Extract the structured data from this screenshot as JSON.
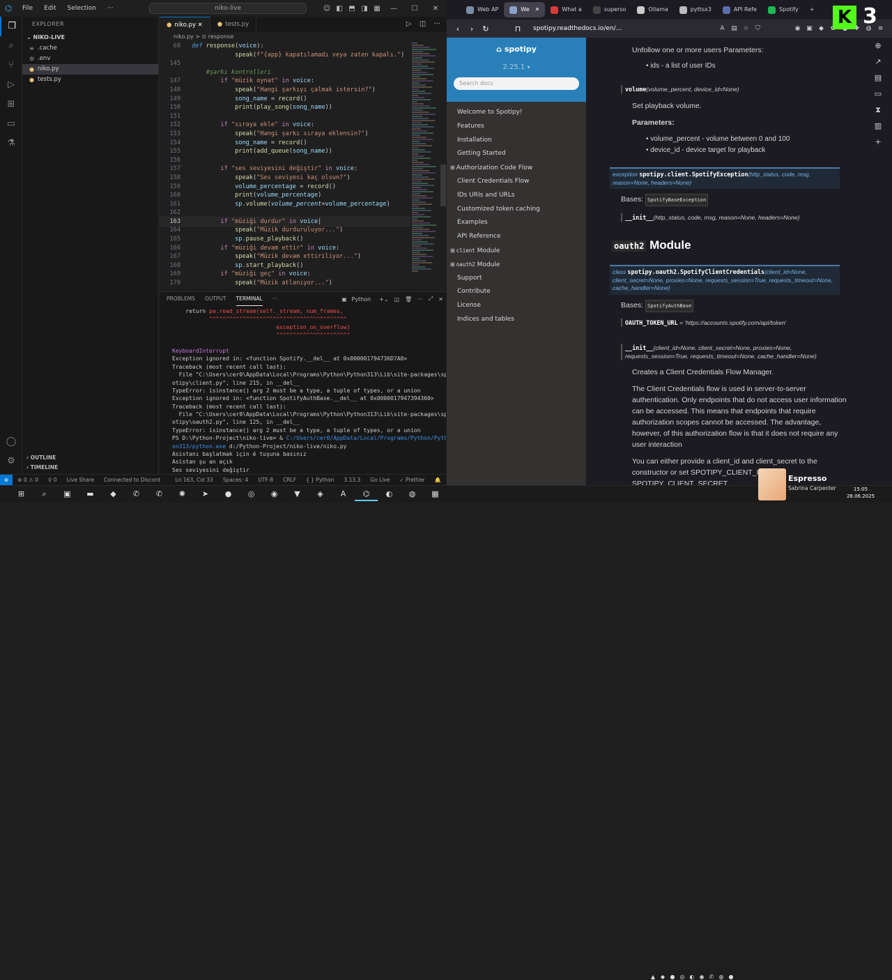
{
  "vscode": {
    "menu": [
      "File",
      "Edit",
      "Selection",
      "···"
    ],
    "command_center": "niko-live",
    "explorer": {
      "title": "EXPLORER",
      "folder": "NIKO-LIVE",
      "files": [
        {
          "name": ".cache",
          "icon": "≡"
        },
        {
          "name": ".env",
          "icon": "⚙"
        },
        {
          "name": "niko.py",
          "icon": "●"
        },
        {
          "name": "tests.py",
          "icon": "●"
        }
      ],
      "outline": "OUTLINE",
      "timeline": "TIMELINE"
    },
    "tabs": [
      {
        "label": "niko.py",
        "active": true
      },
      {
        "label": "tests.py",
        "active": false
      }
    ],
    "breadcrumb": "niko.py  >  ⊙ response",
    "code": [
      {
        "n": "68",
        "html": "<span class='def'>def</span> <span class='fn'>response</span>(<span class='var'>voice</span>):"
      },
      {
        "n": "",
        "html": "            <span class='fn'>speak</span>(<span class='str'>f\"{app} kapatılamadı veya zaten kapalı.\"</span>)"
      },
      {
        "n": "145",
        "html": ""
      },
      {
        "n": "",
        "html": "    <span class='cm'>#şarkı kontrolleri</span>"
      },
      {
        "n": "147",
        "html": "        <span class='kw'>if</span> <span class='str'>\"müzik oynat\"</span> <span class='kw'>in</span> <span class='var'>voice</span>:"
      },
      {
        "n": "148",
        "html": "            <span class='fn'>speak</span>(<span class='str'>\"Hangi şarkıyı çalmak istersin?\"</span>)"
      },
      {
        "n": "149",
        "html": "            <span class='var'>song_name</span> = <span class='fn'>record</span>()"
      },
      {
        "n": "150",
        "html": "            <span class='fn'>print</span>(<span class='fn'>play_song</span>(<span class='var'>song_name</span>))"
      },
      {
        "n": "151",
        "html": ""
      },
      {
        "n": "152",
        "html": "        <span class='kw'>if</span> <span class='str'>\"sıraya ekle\"</span> <span class='kw'>in</span> <span class='var'>voice</span>:"
      },
      {
        "n": "153",
        "html": "            <span class='fn'>speak</span>(<span class='str'>\"Hangi şarkı sıraya eklensin?\"</span>)"
      },
      {
        "n": "154",
        "html": "            <span class='var'>song_name</span> = <span class='fn'>record</span>()"
      },
      {
        "n": "155",
        "html": "            <span class='fn'>print</span>(<span class='fn'>add_queue</span>(<span class='var'>song_name</span>))"
      },
      {
        "n": "156",
        "html": ""
      },
      {
        "n": "157",
        "html": "        <span class='kw'>if</span> <span class='str'>\"ses seviyesini değiştir\"</span> <span class='kw'>in</span> <span class='var'>voice</span>:"
      },
      {
        "n": "158",
        "html": "            <span class='fn'>speak</span>(<span class='str'>\"Ses seviyesi kaç olsun?\"</span>)"
      },
      {
        "n": "159",
        "html": "            <span class='var'>volume_percentage</span> = <span class='fn'>record</span>()"
      },
      {
        "n": "160",
        "html": "            <span class='fn'>print</span>(<span class='var'>volume_percentage</span>)"
      },
      {
        "n": "161",
        "html": "            <span class='var'>sp</span>.<span class='fn'>volume</span>(<span class='var' style='font-style:italic'>volume_percent</span>=<span class='var'>volume_percentage</span>)"
      },
      {
        "n": "162",
        "html": ""
      },
      {
        "n": "163",
        "html": "        <span class='kw'>if</span> <span class='str'>\"müziği durdur\"</span> <span class='kw'>in</span> <span class='var'>voice</span>|",
        "cur": true
      },
      {
        "n": "164",
        "html": "            <span class='fn'>speak</span>(<span class='str'>\"Müzik durduruluyor...\"</span>)"
      },
      {
        "n": "165",
        "html": "            <span class='var'>sp</span>.<span class='fn'>pause_playback</span>()"
      },
      {
        "n": "166",
        "html": "        <span class='kw'>if</span> <span class='str'>\"müziği devam ettir\"</span> <span class='kw'>in</span> <span class='var'>voice</span>:"
      },
      {
        "n": "167",
        "html": "            <span class='fn'>speak</span>(<span class='str'>\"Müzik devam ettiriliyor...\"</span>)"
      },
      {
        "n": "168",
        "html": "            <span class='var'>sp</span>.<span class='fn'>start_playback</span>()"
      },
      {
        "n": "169",
        "html": "        <span class='kw'>if</span> <span class='str'>\"müziği geç\"</span> <span class='kw'>in</span> <span class='var'>voice</span>:"
      },
      {
        "n": "170",
        "html": "            <span class='fn'>speak</span>(<span class='str'>\"Müzik atlanıyor...\"</span>)"
      }
    ],
    "panel_tabs": [
      {
        "label": "PROBLEMS",
        "active": false
      },
      {
        "label": "OUTPUT",
        "active": false
      },
      {
        "label": "TERMINAL",
        "active": true
      },
      {
        "label": "···",
        "active": false
      }
    ],
    "terminal_profile": "Python",
    "terminal": [
      {
        "cls": "",
        "html": "    return <span class='red'>pa.read_stream(self._stream, num_frames,</span>"
      },
      {
        "cls": "err",
        "html": "           ^^^^^^^^^^^^^^^^^^^^^^^^^^^^^^^^^^^^^^^^^"
      },
      {
        "cls": "err",
        "html": "                               exception_on_overflow)"
      },
      {
        "cls": "err",
        "html": "                               ^^^^^^^^^^^^^^^^^^^^^^"
      },
      {
        "cls": "",
        "html": ""
      },
      {
        "cls": "purple",
        "html": "KeyboardInterrupt"
      },
      {
        "cls": "",
        "html": "Exception ignored in: &lt;function Spotify.__del__ at 0x000001794736D7A0&gt;"
      },
      {
        "cls": "",
        "html": "Traceback (most recent call last):"
      },
      {
        "cls": "",
        "html": "  File \"C:\\Users\\cer0\\AppData\\Local\\Programs\\Python\\Python313\\Lib\\site-packages\\sp"
      },
      {
        "cls": "",
        "html": "otipy\\client.py\", line 215, in __del__"
      },
      {
        "cls": "",
        "html": "TypeError: isinstance() arg 2 must be a type, a tuple of types, or a union"
      },
      {
        "cls": "",
        "html": "Exception ignored in: &lt;function SpotifyAuthBase.__del__ at 0x0000017947394360&gt;"
      },
      {
        "cls": "",
        "html": "Traceback (most recent call last):"
      },
      {
        "cls": "",
        "html": "  File \"C:\\Users\\cer0\\AppData\\Local\\Programs\\Python\\Python313\\Lib\\site-packages\\sp"
      },
      {
        "cls": "",
        "html": "otipy\\oauth2.py\", line 125, in __del__"
      },
      {
        "cls": "",
        "html": "TypeError: isinstance() arg 2 must be a type, a tuple of types, or a union"
      },
      {
        "cls": "",
        "html": "PS D:\\Python-Project\\niko-live&gt; &amp; <span class='path'>C:/Users/cer0/AppData/Local/Programs/Python/Pyth</span>"
      },
      {
        "cls": "",
        "html": "<span class='path'>on313/python.exe</span> d:/Python-Project/niko-live/niko.py"
      },
      {
        "cls": "",
        "html": "Asistanı başlatmak için é tuşuna basınız"
      },
      {
        "cls": "",
        "html": "Asistan şu an açık"
      },
      {
        "cls": "",
        "html": "Ses seviyesini değiştir"
      }
    ],
    "status": {
      "remote": "⊗",
      "problems": "⊗ 0 ⚠ 0",
      "ports": "⚲ 0",
      "live_share": "Live Share",
      "discord": "Connected to Discord",
      "position": "Ln 163, Col 33",
      "spaces": "Spaces: 4",
      "encoding": "UTF-8",
      "eol": "CRLF",
      "language": "{ } Python",
      "version": "3.13.3",
      "golive": "Go Live",
      "prettier": "✓ Prettier"
    }
  },
  "browser": {
    "tabs": [
      {
        "label": "Web AP",
        "color": "#7b8ea8",
        "active": false
      },
      {
        "label": "We",
        "color": "#8aa0c8",
        "active": true
      },
      {
        "label": "What a",
        "color": "#d63c3c",
        "active": false
      },
      {
        "label": "superso",
        "color": "#444444",
        "active": false
      },
      {
        "label": "Ollama",
        "color": "#cccccc",
        "active": false
      },
      {
        "label": "pyttsx3",
        "color": "#bbbbbb",
        "active": false
      },
      {
        "label": "API Refe",
        "color": "#5a6ea8",
        "active": false
      },
      {
        "label": "Spotify",
        "color": "#1db954",
        "active": false
      }
    ],
    "url": "spotipy.readthedocs.io/en/...",
    "docs": {
      "brand": "⌂ spotipy",
      "version": "2.25.1",
      "search_placeholder": "Search docs",
      "nav": [
        {
          "label": "Welcome to Spotipy!",
          "plus": false
        },
        {
          "label": "Features",
          "plus": false
        },
        {
          "label": "Installation",
          "plus": false
        },
        {
          "label": "Getting Started",
          "plus": false
        },
        {
          "label": "Authorization Code Flow",
          "plus": true
        },
        {
          "label": "Client Credentials Flow",
          "plus": false
        },
        {
          "label": "IDs URIs and URLs",
          "plus": false
        },
        {
          "label": "Customized token caching",
          "plus": false
        },
        {
          "label": "Examples",
          "plus": false
        },
        {
          "label": "API Reference",
          "plus": false
        },
        {
          "label": "client Module",
          "plus": true,
          "code": "client"
        },
        {
          "label": "oauth2 Module",
          "plus": true,
          "code": "oauth2"
        },
        {
          "label": "Support",
          "plus": false
        },
        {
          "label": "Contribute",
          "plus": false
        },
        {
          "label": "License",
          "plus": false
        },
        {
          "label": "Indices and tables",
          "plus": false
        }
      ],
      "content": {
        "unfollow": "Unfollow one or more users Parameters:",
        "ids_bullet": "ids - a list of user IDs",
        "volume_sig_name": "volume",
        "volume_sig_params": "(volume_percent, device_id=None)",
        "set_volume": "Set playback volume.",
        "parameters": "Parameters:",
        "bullet1": "volume_percent - volume between 0 and 100",
        "bullet2": "device_id - device target for playback",
        "exc_kw": "exception",
        "exc_name": "spotipy.client.SpotifyException",
        "exc_params": "(http_status, code, msg, reason=None, headers=None)",
        "bases": "Bases:",
        "exc_base": "SpotifyBaseException",
        "init1_name": "__init__",
        "init1_params": "(http_status, code, msg, reason=None, headers=None)",
        "module_code": "oauth2",
        "module_word": "Module",
        "class_kw": "class",
        "class_name": "spotipy.oauth2.SpotifyClientCredentials",
        "class_params": "(client_id=None, client_secret=None, proxies=None, requests_session=True, requests_timeout=None, cache_handler=None)",
        "class_base": "SpotifyAuthBase",
        "token_url_name": "OAUTH_TOKEN_URL",
        "token_url_value": " = 'https://accounts.spotify.com/api/token'",
        "init2_name": "__init__",
        "init2_params": "(client_id=None, client_secret=None, proxies=None, requests_session=True, requests_timeout=None, cache_handler=None)",
        "creates": "Creates a Client Credentials Flow Manager.",
        "cc_para": "The Client Credentials flow is used in server-to-server authentication. Only endpoints that do not access user information can be accessed. This means that endpoints that require authorization scopes cannot be accessed. The advantage, however, of this authorization flow is that it does not require any user interaction",
        "provide_para": "You can either provide a client_id and client_secret to the constructor or set SPOTIPY_CLIENT_ID and SPOTIPY_CLIENT_SECRET"
      }
    }
  },
  "overlay": {
    "kick_letter": "K",
    "kick_count": "3"
  },
  "media": {
    "title": "Espresso",
    "artist": "Sabrina Carpenter"
  },
  "clock": {
    "time": "15:05",
    "date": "28.06.2025"
  }
}
